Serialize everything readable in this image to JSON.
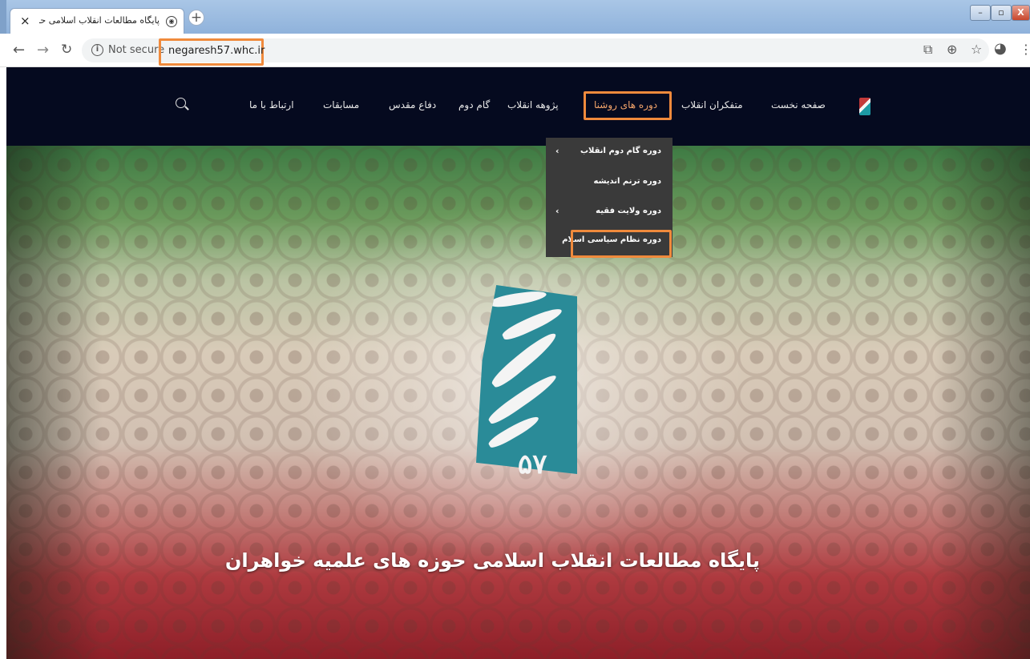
{
  "browser": {
    "tab_title": "پایگاه مطالعات انقلاب اسلامی حوزه های خ",
    "tab_close": "×",
    "new_tab": "+",
    "address_security": "Not secure",
    "address_url": "negaresh57.whc.ir",
    "window_controls": {
      "minimize": "–",
      "maximize": "▫",
      "close": "X"
    },
    "icons": [
      "back-arrow-icon",
      "forward-arrow-icon",
      "reload-icon",
      "info-icon",
      "translate-icon",
      "zoom-icon",
      "star-icon",
      "account-icon",
      "more-icon"
    ]
  },
  "site_nav": {
    "items": [
      {
        "label": "صفحه نخست"
      },
      {
        "label": "متفکران انقلاب"
      },
      {
        "label": "دوره های روشنا",
        "active": true
      },
      {
        "label": "پژوهه انقلاب"
      },
      {
        "label": "گام دوم"
      },
      {
        "label": "دفاع مقدس"
      },
      {
        "label": "مسابقات"
      },
      {
        "label": "ارتباط با ما"
      }
    ],
    "active_color": "#f3a46a"
  },
  "dropdown": {
    "items": [
      {
        "label": "دوره گام دوم انقلاب",
        "has_submenu": true
      },
      {
        "label": "دوره ترنم اندیشه",
        "has_submenu": false
      },
      {
        "label": "دوره ولایت فقیه",
        "has_submenu": true
      },
      {
        "label": "دوره نظام سیاسی اسلام",
        "has_submenu": false
      }
    ],
    "chevron": "‹"
  },
  "hero": {
    "logo_number": "۵۷",
    "title": "پایگاه مطالعات انقلاب اسلامی حوزه های علمیه خواهران"
  },
  "colors": {
    "highlight": "#f08a3c",
    "nav_bg": "#050a1f",
    "logo_teal": "#2a8b98",
    "dropdown_bg": "#3a3a3a"
  }
}
